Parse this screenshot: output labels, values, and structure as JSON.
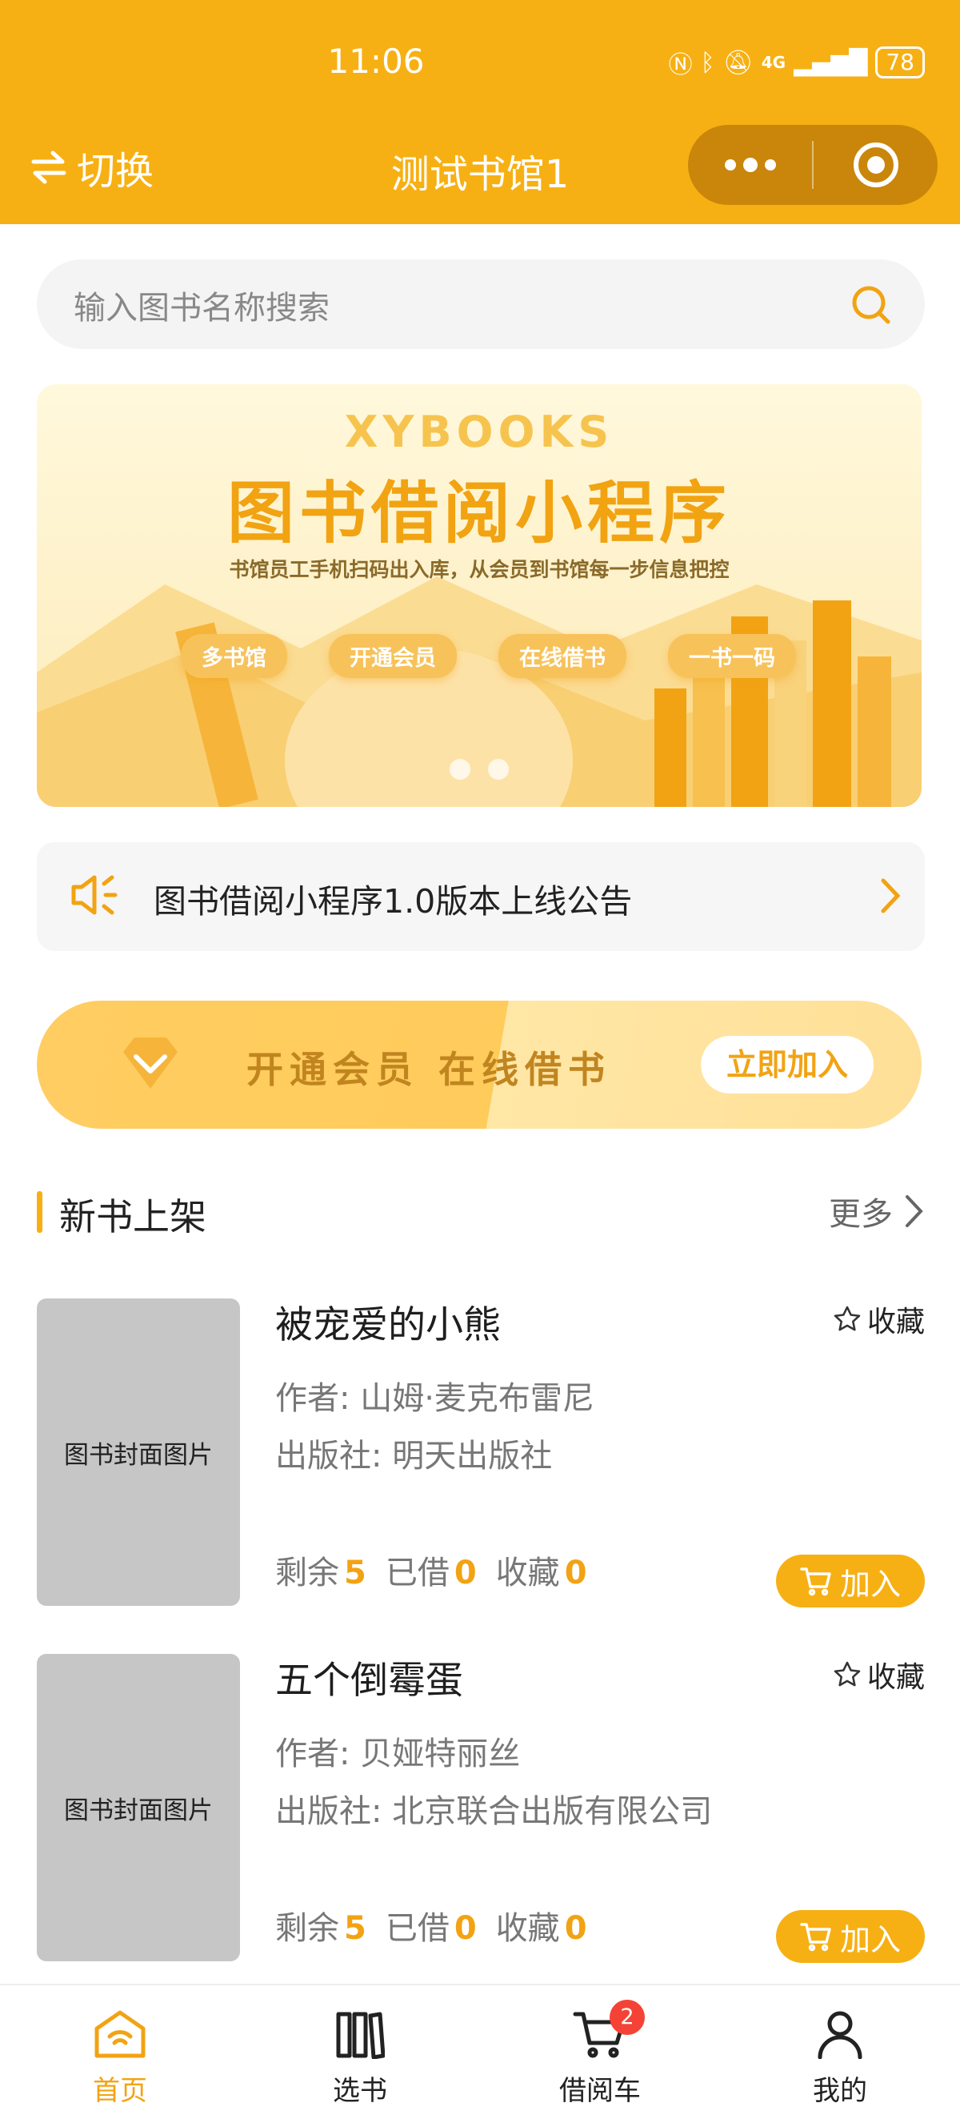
{
  "status": {
    "time": "11:06",
    "network": "4G",
    "battery": "78"
  },
  "nav": {
    "switch_label": "切换",
    "title": "测试书馆1"
  },
  "search": {
    "placeholder": "输入图书名称搜索"
  },
  "banner": {
    "brand": "XYBOOKS",
    "title": "图书借阅小程序",
    "subtitle": "书馆员工手机扫码出入库，从会员到书馆每一步信息把控",
    "tags": [
      "多书馆",
      "开通会员",
      "在线借书",
      "一书一码"
    ],
    "slides": 2
  },
  "notice": {
    "text": "图书借阅小程序1.0版本上线公告"
  },
  "vip": {
    "text": "开通会员 在线借书",
    "button": "立即加入"
  },
  "section": {
    "title": "新书上架",
    "more": "更多"
  },
  "books": [
    {
      "cover": "图书封面图片",
      "title": "被宠爱的小熊",
      "fav_label": "收藏",
      "author_label": "作者:",
      "author": "山姆·麦克布雷尼",
      "publisher_label": "出版社:",
      "publisher": "明天出版社",
      "remain_label": "剩余",
      "remain": "5",
      "borrowed_label": "已借",
      "borrowed": "0",
      "fav_count_label": "收藏",
      "fav_count": "0",
      "add_label": "加入"
    },
    {
      "cover": "图书封面图片",
      "title": "五个倒霉蛋",
      "fav_label": "收藏",
      "author_label": "作者:",
      "author": "贝娅特丽丝",
      "publisher_label": "出版社:",
      "publisher": "北京联合出版有限公司",
      "remain_label": "剩余",
      "remain": "5",
      "borrowed_label": "已借",
      "borrowed": "0",
      "fav_count_label": "收藏",
      "fav_count": "0",
      "add_label": "加入"
    }
  ],
  "tabbar": {
    "items": [
      {
        "label": "首页",
        "icon": "home-icon",
        "active": true
      },
      {
        "label": "选书",
        "icon": "books-icon"
      },
      {
        "label": "借阅车",
        "icon": "cart-icon",
        "badge": "2"
      },
      {
        "label": "我的",
        "icon": "user-icon"
      }
    ]
  },
  "colors": {
    "accent": "#f7b013",
    "accent_text": "#f2a313",
    "badge": "#f44336"
  }
}
